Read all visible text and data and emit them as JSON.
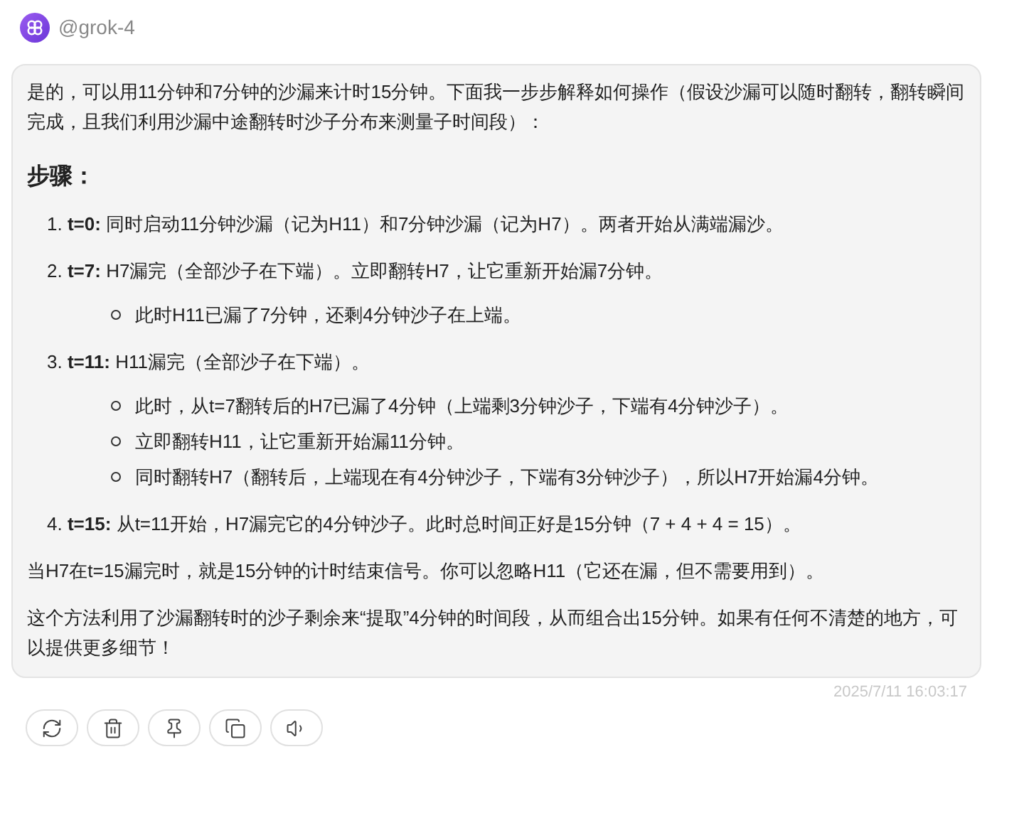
{
  "author": {
    "name": "@grok-4"
  },
  "message": {
    "intro": "是的，可以用11分钟和7分钟的沙漏来计时15分钟。下面我一步步解释如何操作（假设沙漏可以随时翻转，翻转瞬间完成，且我们利用沙漏中途翻转时沙子分布来测量子时间段）：",
    "heading": "步骤：",
    "steps": [
      {
        "number": "1.",
        "label": "t=0:",
        "text": "同时启动11分钟沙漏（记为H11）和7分钟沙漏（记为H7）。两者开始从满端漏沙。"
      },
      {
        "number": "2.",
        "label": "t=7:",
        "text": "H7漏完（全部沙子在下端）。立即翻转H7，让它重新开始漏7分钟。",
        "notes": [
          "此时H11已漏了7分钟，还剩4分钟沙子在上端。"
        ]
      },
      {
        "number": "3.",
        "label": "t=11:",
        "text": "H11漏完（全部沙子在下端）。",
        "notes": [
          "此时，从t=7翻转后的H7已漏了4分钟（上端剩3分钟沙子，下端有4分钟沙子）。",
          "立即翻转H11，让它重新开始漏11分钟。",
          "同时翻转H7（翻转后，上端现在有4分钟沙子，下端有3分钟沙子），所以H7开始漏4分钟。"
        ]
      },
      {
        "number": "4.",
        "label": "t=15:",
        "text": "从t=11开始，H7漏完它的4分钟沙子。此时总时间正好是15分钟（7 + 4 + 4 = 15）。"
      }
    ],
    "paragraphs": [
      "当H7在t=15漏完时，就是15分钟的计时结束信号。你可以忽略H11（它还在漏，但不需要用到）。",
      "这个方法利用了沙漏翻转时的沙子剩余来“提取”4分钟的时间段，从而组合出15分钟。如果有任何不清楚的地方，可以提供更多细节！"
    ]
  },
  "timestamp": "2025/7/11 16:03:17",
  "actions": [
    {
      "kind": "regenerate"
    },
    {
      "kind": "delete"
    },
    {
      "kind": "pin"
    },
    {
      "kind": "copy"
    },
    {
      "kind": "speak"
    }
  ]
}
